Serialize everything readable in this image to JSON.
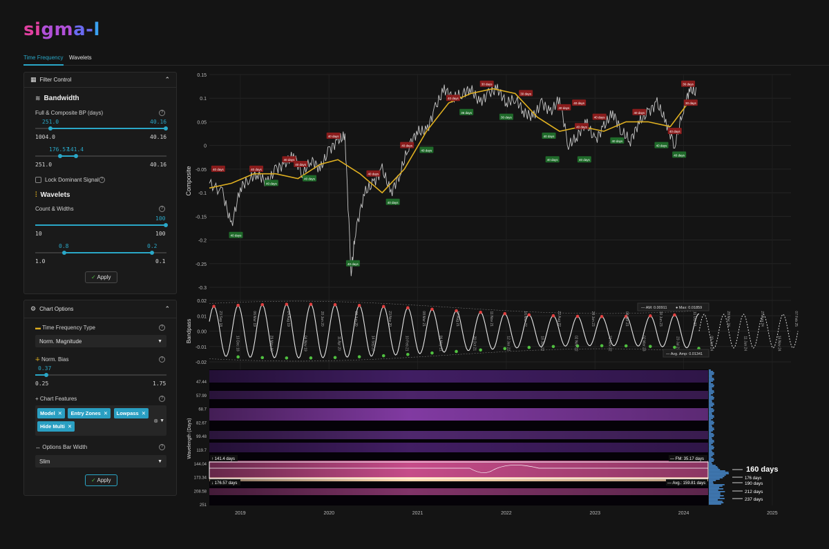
{
  "logo": {
    "p1": "si",
    "p2": "gm",
    "p3": "a-",
    "p4": "l"
  },
  "tabs": [
    {
      "label": "Time Frequency"
    },
    {
      "label": "Wavelets"
    }
  ],
  "filter": {
    "title": "Filter Control",
    "bandwidth_title": "Bandwidth",
    "bp_label": "Full & Composite BP (days)",
    "s1_top_left": "251.0",
    "s1_top_right": "40.16",
    "s1_min": "1004.0",
    "s1_max": "40.16",
    "s2_top_left": "176.57",
    "s2_top_right": "141.4",
    "s2_min": "251.0",
    "s2_max": "40.16",
    "lock_label": "Lock Dominant Signal",
    "wavelets_title": "Wavelets",
    "count_label": "Count & Widths",
    "s3_top": "100",
    "s3_min": "10",
    "s3_max": "100",
    "s4_top_left": "0.8",
    "s4_top_right": "0.2",
    "s4_min": "1.0",
    "s4_max": "0.1",
    "apply": "Apply"
  },
  "chart_options": {
    "title": "Chart Options",
    "tf_label": "Time Frequency Type",
    "tf_value": "Norm. Magnitude",
    "bias_label": "Norm. Bias",
    "bias_top": "0.37",
    "bias_min": "0.25",
    "bias_max": "1.75",
    "features_label": "Chart Features",
    "features": [
      "Model",
      "Entry Zones",
      "Lowpass",
      "Hide Multi"
    ],
    "bar_label": "Options Bar Width",
    "bar_value": "Slim",
    "apply": "Apply"
  },
  "colors": {
    "accent": "#2aa8c8",
    "composite": "#c8c8c8",
    "lowpass": "#e0b020",
    "peak": "#e04040",
    "trough": "#50c040"
  },
  "chart_data": [
    {
      "type": "line",
      "ylabel": "Composite",
      "ylim": [
        -0.3,
        0.15
      ],
      "yticks": [
        "0.15",
        "0.1",
        "0.05",
        "0",
        "-0.05",
        "-0.1",
        "-0.15",
        "-0.2",
        "-0.25",
        "-0.3"
      ],
      "x_years": [
        "2019",
        "2020",
        "2021",
        "2022",
        "2023",
        "2024",
        "2025"
      ],
      "series": [
        {
          "x": [
            2018.65,
            2018.8,
            2018.9,
            2019.0,
            2019.1,
            2019.2,
            2019.3,
            2019.4,
            2019.5,
            2019.6,
            2019.7,
            2019.8,
            2019.9,
            2020.0,
            2020.1,
            2020.18,
            2020.25,
            2020.3,
            2020.4,
            2020.5,
            2020.6,
            2020.7,
            2020.8,
            2020.9,
            2021.0,
            2021.1,
            2021.2,
            2021.3,
            2021.4,
            2021.5,
            2021.6,
            2021.7,
            2021.8,
            2021.9,
            2022.0,
            2022.1,
            2022.2,
            2022.3,
            2022.4,
            2022.5,
            2022.6,
            2022.7,
            2022.8,
            2022.9,
            2023.0,
            2023.1,
            2023.2,
            2023.3,
            2023.4,
            2023.5,
            2023.6,
            2023.7,
            2023.8,
            2023.9,
            2024.0,
            2024.07,
            2024.15
          ],
          "y": [
            -0.08,
            -0.1,
            -0.17,
            -0.09,
            -0.07,
            -0.06,
            -0.08,
            -0.05,
            -0.04,
            -0.02,
            -0.06,
            -0.03,
            -0.05,
            -0.01,
            0.01,
            0.02,
            -0.27,
            -0.18,
            -0.1,
            -0.08,
            -0.05,
            -0.1,
            -0.06,
            0.0,
            0.03,
            0.03,
            0.08,
            0.12,
            0.1,
            0.11,
            0.12,
            0.09,
            0.11,
            0.12,
            0.09,
            0.1,
            0.07,
            0.06,
            0.09,
            0.07,
            0.1,
            0.0,
            0.02,
            0.05,
            0.01,
            0.04,
            0.07,
            0.03,
            0.01,
            0.05,
            0.07,
            0.09,
            0.05,
            0.0,
            0.08,
            0.12,
            0.11
          ]
        },
        {
          "x": [
            2018.65,
            2018.9,
            2019.15,
            2019.4,
            2019.65,
            2019.9,
            2020.1,
            2020.35,
            2020.6,
            2020.85,
            2021.1,
            2021.35,
            2021.6,
            2021.85,
            2022.1,
            2022.35,
            2022.6,
            2022.85,
            2023.1,
            2023.35,
            2023.6,
            2023.85,
            2024.05,
            2024.15
          ],
          "y": [
            -0.09,
            -0.08,
            -0.06,
            -0.06,
            -0.07,
            -0.04,
            -0.03,
            -0.06,
            -0.1,
            -0.05,
            0.03,
            0.09,
            0.11,
            0.12,
            0.11,
            0.06,
            0.03,
            0.04,
            0.03,
            0.05,
            0.05,
            0.04,
            0.09,
            0.09
          ]
        }
      ],
      "annotations": [
        "40 days",
        "40 days",
        "40 days",
        "40 days",
        "40 days",
        "40 days",
        "40 days",
        "40 days",
        "40 days",
        "40 days",
        "40 days",
        "40 days",
        "40 days",
        "40 days",
        "36 days",
        "30 days",
        "30 days",
        "30 days",
        "40 days",
        "40 days",
        "40 days",
        "40 days",
        "40 days",
        "40 days",
        "40 days",
        "40 days",
        "40 days",
        "40 days",
        "36 days",
        "30 days",
        "40 days",
        "40 days"
      ]
    },
    {
      "type": "line",
      "ylabel": "Bandpass",
      "ylim": [
        -0.02,
        0.02
      ],
      "yticks": [
        "0.02",
        "0.01",
        "0.00",
        "-0.01",
        "-0.02"
      ],
      "legend": {
        "am": "AM: 0.00911",
        "max": "Max: 0.01859",
        "avg": "Avg. Amp: 0.01341"
      },
      "date_labels": [
        "23 Sep 18",
        "13 Dec 18",
        "06 Mar 19",
        "29 May 19",
        "14 Aug 19",
        "04 Nov 19",
        "20 Jan 20",
        "11 Apr 20",
        "28 Jun 20",
        "14 Sep 20",
        "23 Nov 20",
        "10 Feb 21",
        "08 Mar 21",
        "06 May 21",
        "17 Aug 21",
        "28 Oct 21",
        "11 Nov 21",
        "12 Jan 22",
        "16 Mar 22",
        "18 Jun 22",
        "22 Aug 22",
        "02 Nov 22",
        "28 Jan 23",
        "21 Nov 22",
        "08 Apr 23",
        "02 Mar 23",
        "30 Jun 23",
        "23 Jul 23",
        "11 Oct 23",
        "09 Jan 24",
        "28 Mar 24",
        "11 Jun 24",
        "27 Aug 24",
        "16 Nov 24",
        "07 Feb 25"
      ]
    },
    {
      "type": "heatmap",
      "ylabel": "Wavelength (Days)",
      "yticks": [
        "47.44",
        "57.99",
        "68.7",
        "82.67",
        "99.48",
        "119.7",
        "144.04",
        "173.34",
        "208.58",
        "251"
      ],
      "band_top_label": "141.4 days",
      "band_bottom_label": "176.57 days",
      "fm_label": "FM: 35.17 days",
      "avg_label": "Avg.: 159.81 days",
      "peaks": [
        "160 days",
        "176 days",
        "190 days",
        "212 days",
        "237 days"
      ]
    }
  ]
}
